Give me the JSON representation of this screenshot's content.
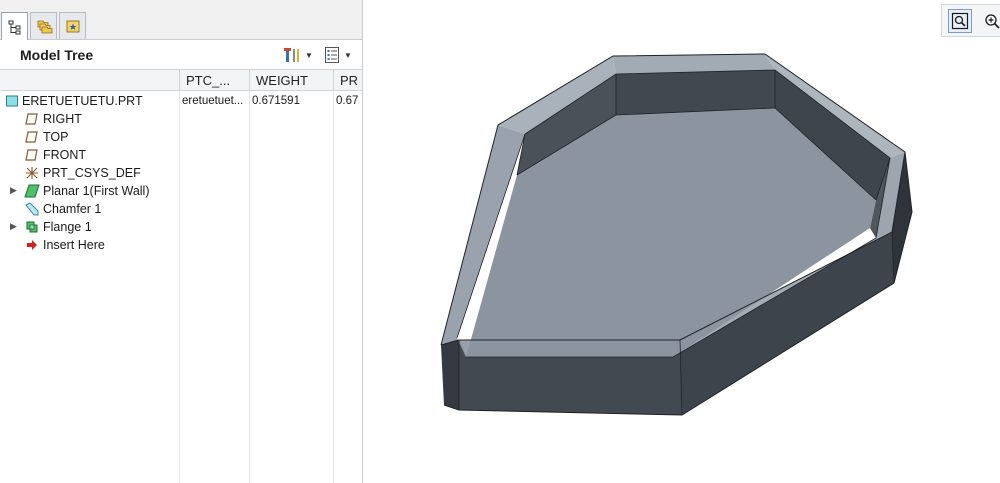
{
  "panel": {
    "title": "Model Tree"
  },
  "columns": {
    "ptc": "PTC_...",
    "weight": "WEIGHT",
    "pr": "PR"
  },
  "tree": {
    "root": {
      "label": "ERETUETUETU.PRT",
      "ptc": "eretuetuet...",
      "weight": "0.671591",
      "pr": "0.67"
    },
    "items": [
      {
        "label": "RIGHT"
      },
      {
        "label": "TOP"
      },
      {
        "label": "FRONT"
      },
      {
        "label": "PRT_CSYS_DEF"
      },
      {
        "label": "Planar 1(First Wall)"
      },
      {
        "label": "Chamfer 1"
      },
      {
        "label": "Flange 1"
      },
      {
        "label": "Insert Here"
      }
    ]
  },
  "icons": {
    "tab_model_tree": "model-tree-icon",
    "tab_folder": "folder-browser-icon",
    "tab_favorites": "favorites-icon",
    "tools": "tree-tools-icon",
    "show": "tree-show-icon",
    "refit": "refit-view-icon",
    "zoom_in": "zoom-in-icon"
  }
}
